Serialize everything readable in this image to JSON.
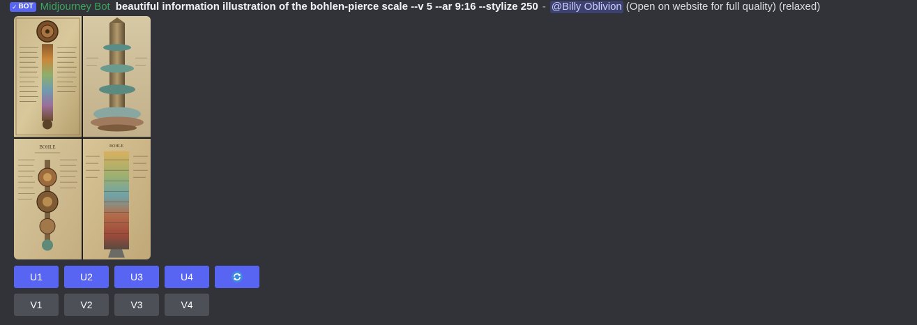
{
  "message": {
    "bot_tag": "BOT",
    "author": "Midjourney Bot",
    "prompt": "beautiful information illustration of the bohlen-pierce scale --v 5 --ar 9:16 --stylize 250",
    "separator": "-",
    "mention": "@Billy Oblivion",
    "suffix": "(Open on website for full quality) (relaxed)"
  },
  "image_grid": {
    "tiles": [
      "tile-1",
      "tile-2",
      "tile-3",
      "tile-4"
    ],
    "tile3_heading": "BOHLE",
    "tile4_heading": "BOHLE"
  },
  "buttons": {
    "upscale": [
      "U1",
      "U2",
      "U3",
      "U4"
    ],
    "reroll_icon": "refresh-icon",
    "variation": [
      "V1",
      "V2",
      "V3",
      "V4"
    ]
  },
  "colors": {
    "background": "#313338",
    "author": "#3ba55c",
    "blurple": "#5865f2",
    "secondary_button": "#4e5058"
  }
}
